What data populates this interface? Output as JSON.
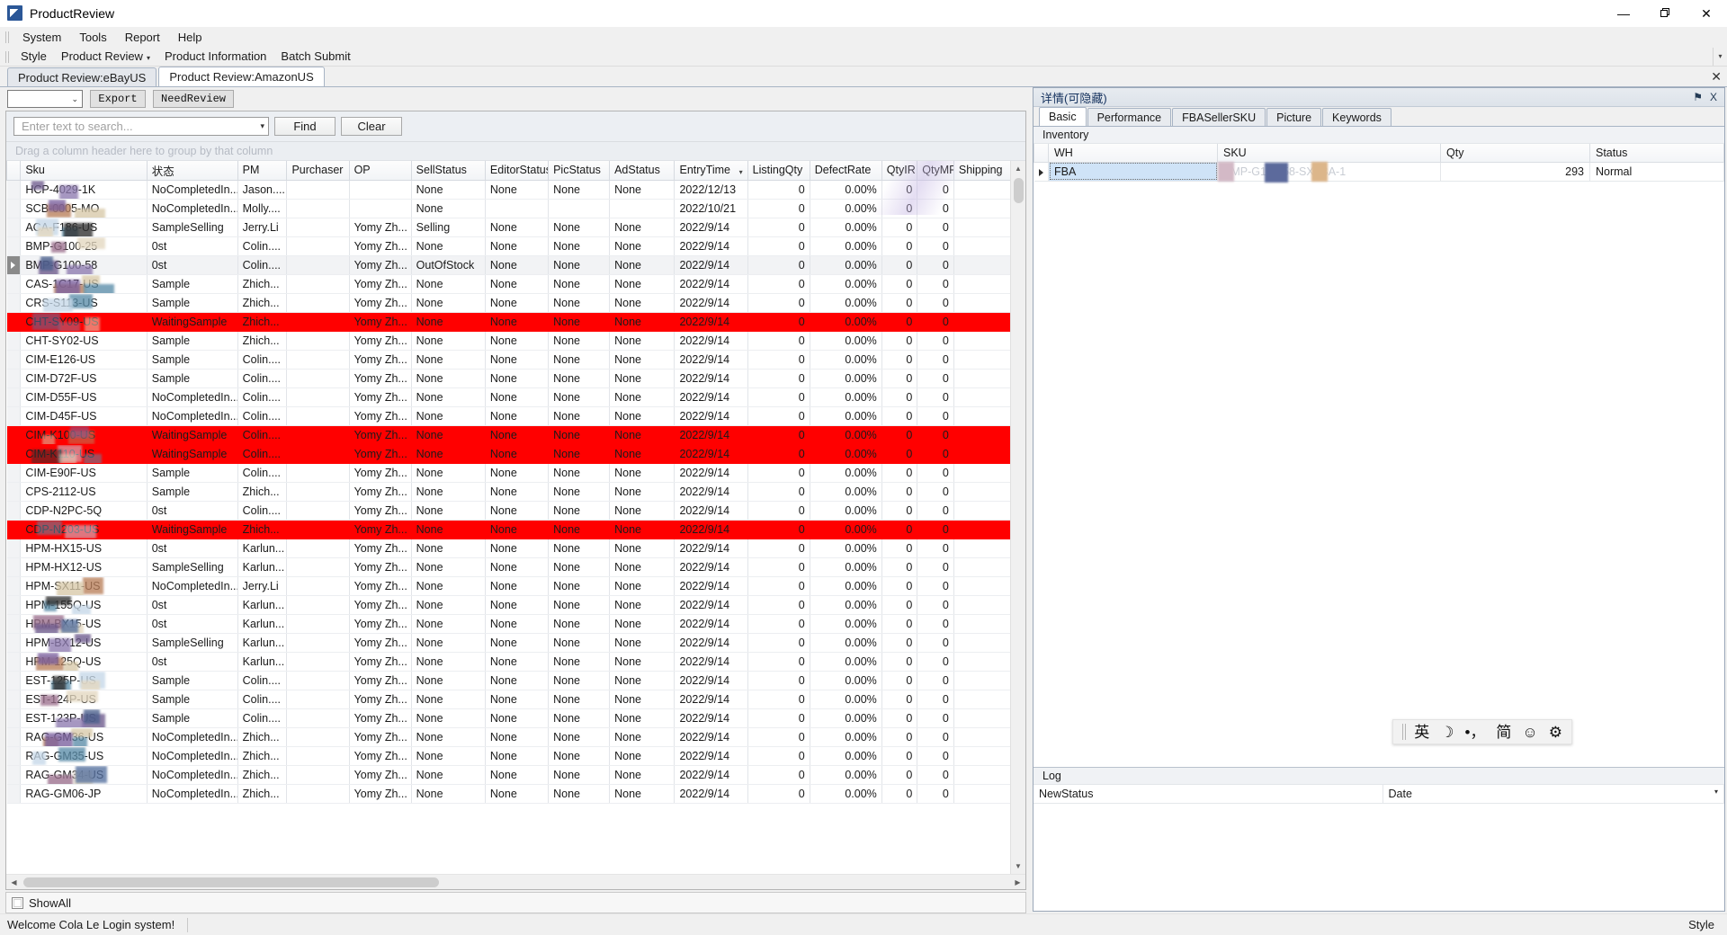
{
  "window": {
    "title": "ProductReview",
    "icon": "app-icon",
    "minimize": "—",
    "maximize": "❐",
    "close": "✕"
  },
  "menubar": {
    "items": [
      "System",
      "Tools",
      "Report",
      "Help"
    ]
  },
  "toolstrip": {
    "items": [
      "Style",
      "Product Review",
      "Product Information",
      "Batch Submit"
    ],
    "dropdown_caret": "▾",
    "overflow": "▾"
  },
  "doc_tabs": {
    "tabs": [
      {
        "label": "Product Review:eBayUS",
        "active": false
      },
      {
        "label": "Product Review:AmazonUS",
        "active": true
      }
    ],
    "close_label": "✕"
  },
  "sub_toolbar": {
    "combo_value": "",
    "combo_caret": "⌄",
    "export_label": "Export",
    "needreview_label": "NeedReview"
  },
  "search": {
    "placeholder": "Enter text to search...",
    "value": "",
    "caret": "▾",
    "find_label": "Find",
    "clear_label": "Clear"
  },
  "grid": {
    "group_hint": "Drag a column header here to group by that column",
    "sort_column": "EntryTime",
    "sort_caret": "▾",
    "columns": [
      "Sku",
      "状态",
      "PM",
      "Purchaser",
      "OP",
      "SellStatus",
      "EditorStatus",
      "PicStatus",
      "AdStatus",
      "EntryTime",
      "ListingQty",
      "DefectRate",
      "QtyIR",
      "QtyMP",
      "Shipping"
    ],
    "rows": [
      {
        "sku": "HCP-4029-1K",
        "status": "NoCompletedIn...",
        "pm": "Jason....",
        "purchaser": "",
        "op": "",
        "sellstatus": "None",
        "editorstatus": "None",
        "picstatus": "None",
        "adstatus": "None",
        "entrytime": "2022/12/13",
        "listingqty": "0",
        "defectrate": "0.00%",
        "qtyir": "0",
        "qtymp": "0",
        "shipping": "",
        "state": "normal",
        "masked": true
      },
      {
        "sku": "SCB-0005-MO",
        "status": "NoCompletedIn...",
        "pm": "Molly....",
        "purchaser": "",
        "op": "",
        "sellstatus": "None",
        "editorstatus": "",
        "picstatus": "",
        "adstatus": "",
        "entrytime": "2022/10/21",
        "listingqty": "0",
        "defectrate": "0.00%",
        "qtyir": "0",
        "qtymp": "0",
        "shipping": "",
        "state": "normal",
        "masked": true
      },
      {
        "sku": "ACA-F186-US",
        "status": "SampleSelling",
        "pm": "Jerry.Li",
        "purchaser": "",
        "op": "Yomy Zh...",
        "sellstatus": "Selling",
        "editorstatus": "None",
        "picstatus": "None",
        "adstatus": "None",
        "entrytime": "2022/9/14",
        "listingqty": "0",
        "defectrate": "0.00%",
        "qtyir": "0",
        "qtymp": "0",
        "shipping": "",
        "state": "normal",
        "masked": true
      },
      {
        "sku": "BMP-G100-25",
        "status": "0st",
        "pm": "Colin....",
        "purchaser": "",
        "op": "Yomy Zh...",
        "sellstatus": "None",
        "editorstatus": "None",
        "picstatus": "None",
        "adstatus": "None",
        "entrytime": "2022/9/14",
        "listingqty": "0",
        "defectrate": "0.00%",
        "qtyir": "0",
        "qtymp": "0",
        "shipping": "",
        "state": "normal",
        "masked": true
      },
      {
        "sku": "BMP-G100-58",
        "status": "0st",
        "pm": "Colin....",
        "purchaser": "",
        "op": "Yomy Zh...",
        "sellstatus": "OutOfStock",
        "editorstatus": "None",
        "picstatus": "None",
        "adstatus": "None",
        "entrytime": "2022/9/14",
        "listingqty": "0",
        "defectrate": "0.00%",
        "qtyir": "0",
        "qtymp": "0",
        "shipping": "",
        "state": "current",
        "masked": true
      },
      {
        "sku": "CAS-1C17-US",
        "status": "Sample",
        "pm": "Zhich...",
        "purchaser": "",
        "op": "Yomy Zh...",
        "sellstatus": "None",
        "editorstatus": "None",
        "picstatus": "None",
        "adstatus": "None",
        "entrytime": "2022/9/14",
        "listingqty": "0",
        "defectrate": "0.00%",
        "qtyir": "0",
        "qtymp": "0",
        "shipping": "",
        "state": "normal",
        "masked": true
      },
      {
        "sku": "CRS-S113-US",
        "status": "Sample",
        "pm": "Zhich...",
        "purchaser": "",
        "op": "Yomy Zh...",
        "sellstatus": "None",
        "editorstatus": "None",
        "picstatus": "None",
        "adstatus": "None",
        "entrytime": "2022/9/14",
        "listingqty": "0",
        "defectrate": "0.00%",
        "qtyir": "0",
        "qtymp": "0",
        "shipping": "",
        "state": "normal",
        "masked": true
      },
      {
        "sku": "CHT-SY09-US",
        "status": "WaitingSample",
        "pm": "Zhich...",
        "purchaser": "",
        "op": "Yomy Zh...",
        "sellstatus": "None",
        "editorstatus": "None",
        "picstatus": "None",
        "adstatus": "None",
        "entrytime": "2022/9/14",
        "listingqty": "0",
        "defectrate": "0.00%",
        "qtyir": "0",
        "qtymp": "0",
        "shipping": "",
        "state": "danger",
        "masked": true
      },
      {
        "sku": "CHT-SY02-US",
        "status": "Sample",
        "pm": "Zhich...",
        "purchaser": "",
        "op": "Yomy Zh...",
        "sellstatus": "None",
        "editorstatus": "None",
        "picstatus": "None",
        "adstatus": "None",
        "entrytime": "2022/9/14",
        "listingqty": "0",
        "defectrate": "0.00%",
        "qtyir": "0",
        "qtymp": "0",
        "shipping": "",
        "state": "normal",
        "masked": false
      },
      {
        "sku": "CIM-E126-US",
        "status": "Sample",
        "pm": "Colin....",
        "purchaser": "",
        "op": "Yomy Zh...",
        "sellstatus": "None",
        "editorstatus": "None",
        "picstatus": "None",
        "adstatus": "None",
        "entrytime": "2022/9/14",
        "listingqty": "0",
        "defectrate": "0.00%",
        "qtyir": "0",
        "qtymp": "0",
        "shipping": "",
        "state": "normal",
        "masked": false
      },
      {
        "sku": "CIM-D72F-US",
        "status": "Sample",
        "pm": "Colin....",
        "purchaser": "",
        "op": "Yomy Zh...",
        "sellstatus": "None",
        "editorstatus": "None",
        "picstatus": "None",
        "adstatus": "None",
        "entrytime": "2022/9/14",
        "listingqty": "0",
        "defectrate": "0.00%",
        "qtyir": "0",
        "qtymp": "0",
        "shipping": "",
        "state": "normal",
        "masked": false
      },
      {
        "sku": "CIM-D55F-US",
        "status": "NoCompletedIn...",
        "pm": "Colin....",
        "purchaser": "",
        "op": "Yomy Zh...",
        "sellstatus": "None",
        "editorstatus": "None",
        "picstatus": "None",
        "adstatus": "None",
        "entrytime": "2022/9/14",
        "listingqty": "0",
        "defectrate": "0.00%",
        "qtyir": "0",
        "qtymp": "0",
        "shipping": "",
        "state": "normal",
        "masked": false
      },
      {
        "sku": "CIM-D45F-US",
        "status": "NoCompletedIn...",
        "pm": "Colin....",
        "purchaser": "",
        "op": "Yomy Zh...",
        "sellstatus": "None",
        "editorstatus": "None",
        "picstatus": "None",
        "adstatus": "None",
        "entrytime": "2022/9/14",
        "listingqty": "0",
        "defectrate": "0.00%",
        "qtyir": "0",
        "qtymp": "0",
        "shipping": "",
        "state": "normal",
        "masked": false
      },
      {
        "sku": "CIM-K100-US",
        "status": "WaitingSample",
        "pm": "Colin....",
        "purchaser": "",
        "op": "Yomy Zh...",
        "sellstatus": "None",
        "editorstatus": "None",
        "picstatus": "None",
        "adstatus": "None",
        "entrytime": "2022/9/14",
        "listingqty": "0",
        "defectrate": "0.00%",
        "qtyir": "0",
        "qtymp": "0",
        "shipping": "",
        "state": "danger",
        "masked": true
      },
      {
        "sku": "CIM-K110-US",
        "status": "WaitingSample",
        "pm": "Colin....",
        "purchaser": "",
        "op": "Yomy Zh...",
        "sellstatus": "None",
        "editorstatus": "None",
        "picstatus": "None",
        "adstatus": "None",
        "entrytime": "2022/9/14",
        "listingqty": "0",
        "defectrate": "0.00%",
        "qtyir": "0",
        "qtymp": "0",
        "shipping": "",
        "state": "danger",
        "masked": true
      },
      {
        "sku": "CIM-E90F-US",
        "status": "Sample",
        "pm": "Colin....",
        "purchaser": "",
        "op": "Yomy Zh...",
        "sellstatus": "None",
        "editorstatus": "None",
        "picstatus": "None",
        "adstatus": "None",
        "entrytime": "2022/9/14",
        "listingqty": "0",
        "defectrate": "0.00%",
        "qtyir": "0",
        "qtymp": "0",
        "shipping": "",
        "state": "normal",
        "masked": false
      },
      {
        "sku": "CPS-2112-US",
        "status": "Sample",
        "pm": "Zhich...",
        "purchaser": "",
        "op": "Yomy Zh...",
        "sellstatus": "None",
        "editorstatus": "None",
        "picstatus": "None",
        "adstatus": "None",
        "entrytime": "2022/9/14",
        "listingqty": "0",
        "defectrate": "0.00%",
        "qtyir": "0",
        "qtymp": "0",
        "shipping": "",
        "state": "normal",
        "masked": false
      },
      {
        "sku": "CDP-N2PC-5Q",
        "status": "0st",
        "pm": "Colin....",
        "purchaser": "",
        "op": "Yomy Zh...",
        "sellstatus": "None",
        "editorstatus": "None",
        "picstatus": "None",
        "adstatus": "None",
        "entrytime": "2022/9/14",
        "listingqty": "0",
        "defectrate": "0.00%",
        "qtyir": "0",
        "qtymp": "0",
        "shipping": "",
        "state": "normal",
        "masked": false
      },
      {
        "sku": "CDP-N203-US",
        "status": "WaitingSample",
        "pm": "Zhich...",
        "purchaser": "",
        "op": "Yomy Zh...",
        "sellstatus": "None",
        "editorstatus": "None",
        "picstatus": "None",
        "adstatus": "None",
        "entrytime": "2022/9/14",
        "listingqty": "0",
        "defectrate": "0.00%",
        "qtyir": "0",
        "qtymp": "0",
        "shipping": "",
        "state": "danger",
        "masked": true
      },
      {
        "sku": "HPM-HX15-US",
        "status": "0st",
        "pm": "Karlun...",
        "purchaser": "",
        "op": "Yomy Zh...",
        "sellstatus": "None",
        "editorstatus": "None",
        "picstatus": "None",
        "adstatus": "None",
        "entrytime": "2022/9/14",
        "listingqty": "0",
        "defectrate": "0.00%",
        "qtyir": "0",
        "qtymp": "0",
        "shipping": "",
        "state": "normal",
        "masked": false
      },
      {
        "sku": "HPM-HX12-US",
        "status": "SampleSelling",
        "pm": "Karlun...",
        "purchaser": "",
        "op": "Yomy Zh...",
        "sellstatus": "None",
        "editorstatus": "None",
        "picstatus": "None",
        "adstatus": "None",
        "entrytime": "2022/9/14",
        "listingqty": "0",
        "defectrate": "0.00%",
        "qtyir": "0",
        "qtymp": "0",
        "shipping": "",
        "state": "normal",
        "masked": false
      },
      {
        "sku": "HPM-SX11-US",
        "status": "NoCompletedIn...",
        "pm": "Jerry.Li",
        "purchaser": "",
        "op": "Yomy Zh...",
        "sellstatus": "None",
        "editorstatus": "None",
        "picstatus": "None",
        "adstatus": "None",
        "entrytime": "2022/9/14",
        "listingqty": "0",
        "defectrate": "0.00%",
        "qtyir": "0",
        "qtymp": "0",
        "shipping": "",
        "state": "normal",
        "masked": true
      },
      {
        "sku": "HPM-155Q-US",
        "status": "0st",
        "pm": "Karlun...",
        "purchaser": "",
        "op": "Yomy Zh...",
        "sellstatus": "None",
        "editorstatus": "None",
        "picstatus": "None",
        "adstatus": "None",
        "entrytime": "2022/9/14",
        "listingqty": "0",
        "defectrate": "0.00%",
        "qtyir": "0",
        "qtymp": "0",
        "shipping": "",
        "state": "normal",
        "masked": true
      },
      {
        "sku": "HPM-BX15-US",
        "status": "0st",
        "pm": "Karlun...",
        "purchaser": "",
        "op": "Yomy Zh...",
        "sellstatus": "None",
        "editorstatus": "None",
        "picstatus": "None",
        "adstatus": "None",
        "entrytime": "2022/9/14",
        "listingqty": "0",
        "defectrate": "0.00%",
        "qtyir": "0",
        "qtymp": "0",
        "shipping": "",
        "state": "normal",
        "masked": true
      },
      {
        "sku": "HPM-BX12-US",
        "status": "SampleSelling",
        "pm": "Karlun...",
        "purchaser": "",
        "op": "Yomy Zh...",
        "sellstatus": "None",
        "editorstatus": "None",
        "picstatus": "None",
        "adstatus": "None",
        "entrytime": "2022/9/14",
        "listingqty": "0",
        "defectrate": "0.00%",
        "qtyir": "0",
        "qtymp": "0",
        "shipping": "",
        "state": "normal",
        "masked": true
      },
      {
        "sku": "HPM-125Q-US",
        "status": "0st",
        "pm": "Karlun...",
        "purchaser": "",
        "op": "Yomy Zh...",
        "sellstatus": "None",
        "editorstatus": "None",
        "picstatus": "None",
        "adstatus": "None",
        "entrytime": "2022/9/14",
        "listingqty": "0",
        "defectrate": "0.00%",
        "qtyir": "0",
        "qtymp": "0",
        "shipping": "",
        "state": "normal",
        "masked": true
      },
      {
        "sku": "EST-125P-US",
        "status": "Sample",
        "pm": "Colin....",
        "purchaser": "",
        "op": "Yomy Zh...",
        "sellstatus": "None",
        "editorstatus": "None",
        "picstatus": "None",
        "adstatus": "None",
        "entrytime": "2022/9/14",
        "listingqty": "0",
        "defectrate": "0.00%",
        "qtyir": "0",
        "qtymp": "0",
        "shipping": "",
        "state": "normal",
        "masked": true
      },
      {
        "sku": "EST-124P-US",
        "status": "Sample",
        "pm": "Colin....",
        "purchaser": "",
        "op": "Yomy Zh...",
        "sellstatus": "None",
        "editorstatus": "None",
        "picstatus": "None",
        "adstatus": "None",
        "entrytime": "2022/9/14",
        "listingqty": "0",
        "defectrate": "0.00%",
        "qtyir": "0",
        "qtymp": "0",
        "shipping": "",
        "state": "normal",
        "masked": true
      },
      {
        "sku": "EST-123P-US",
        "status": "Sample",
        "pm": "Colin....",
        "purchaser": "",
        "op": "Yomy Zh...",
        "sellstatus": "None",
        "editorstatus": "None",
        "picstatus": "None",
        "adstatus": "None",
        "entrytime": "2022/9/14",
        "listingqty": "0",
        "defectrate": "0.00%",
        "qtyir": "0",
        "qtymp": "0",
        "shipping": "",
        "state": "normal",
        "masked": true
      },
      {
        "sku": "RAG-GM36-US",
        "status": "NoCompletedIn...",
        "pm": "Zhich...",
        "purchaser": "",
        "op": "Yomy Zh...",
        "sellstatus": "None",
        "editorstatus": "None",
        "picstatus": "None",
        "adstatus": "None",
        "entrytime": "2022/9/14",
        "listingqty": "0",
        "defectrate": "0.00%",
        "qtyir": "0",
        "qtymp": "0",
        "shipping": "",
        "state": "normal",
        "masked": true
      },
      {
        "sku": "RAG-GM35-US",
        "status": "NoCompletedIn...",
        "pm": "Zhich...",
        "purchaser": "",
        "op": "Yomy Zh...",
        "sellstatus": "None",
        "editorstatus": "None",
        "picstatus": "None",
        "adstatus": "None",
        "entrytime": "2022/9/14",
        "listingqty": "0",
        "defectrate": "0.00%",
        "qtyir": "0",
        "qtymp": "0",
        "shipping": "",
        "state": "normal",
        "masked": true
      },
      {
        "sku": "RAG-GM34-US",
        "status": "NoCompletedIn...",
        "pm": "Zhich...",
        "purchaser": "",
        "op": "Yomy Zh...",
        "sellstatus": "None",
        "editorstatus": "None",
        "picstatus": "None",
        "adstatus": "None",
        "entrytime": "2022/9/14",
        "listingqty": "0",
        "defectrate": "0.00%",
        "qtyir": "0",
        "qtymp": "0",
        "shipping": "",
        "state": "normal",
        "masked": true
      },
      {
        "sku": "RAG-GM06-JP",
        "status": "NoCompletedIn...",
        "pm": "Zhich...",
        "purchaser": "",
        "op": "Yomy Zh...",
        "sellstatus": "None",
        "editorstatus": "None",
        "picstatus": "None",
        "adstatus": "None",
        "entrytime": "2022/9/14",
        "listingqty": "0",
        "defectrate": "0.00%",
        "qtyir": "0",
        "qtymp": "0",
        "shipping": "",
        "state": "normal",
        "masked": false
      }
    ]
  },
  "showall": {
    "label": "ShowAll",
    "checked": false
  },
  "details_panel": {
    "title": "详情(可隐藏)",
    "pin_icon": "⚑",
    "close_icon": "X",
    "tabs": [
      {
        "label": "Basic",
        "active": true
      },
      {
        "label": "Performance",
        "active": false
      },
      {
        "label": "FBASellerSKU",
        "active": false
      },
      {
        "label": "Picture",
        "active": false
      },
      {
        "label": "Keywords",
        "active": false
      }
    ],
    "inventory": {
      "section_label": "Inventory",
      "columns": [
        "WH",
        "SKU",
        "Qty",
        "Status"
      ],
      "rows": [
        {
          "wh": "FBA",
          "sku": "BMP-G100-58-SXFBA-1",
          "qty": "293",
          "status": "Normal",
          "masked": true
        }
      ]
    },
    "log": {
      "section_label": "Log",
      "columns": [
        "NewStatus",
        "Date"
      ],
      "caret": "▾",
      "rows": []
    }
  },
  "ime_bar": {
    "icons": [
      "英",
      "☽",
      "•，",
      "简",
      "☺",
      "⚙"
    ]
  },
  "statusbar": {
    "welcome": "Welcome  Cola Le  Login system!",
    "style": "Style"
  },
  "colors": {
    "danger_row": "#ff0000",
    "accent": "#2b5797",
    "panel_title": "#15325e"
  }
}
